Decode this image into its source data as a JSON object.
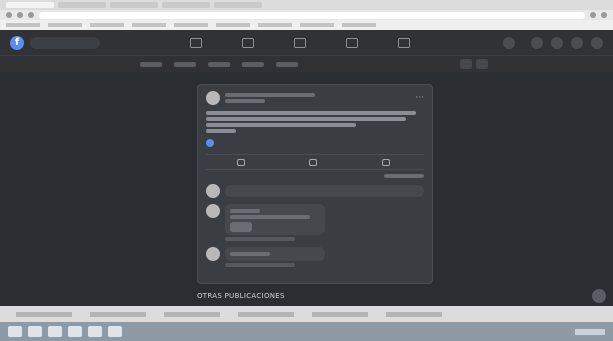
{
  "browser": {
    "address": ""
  },
  "facebook": {
    "search_placeholder": "",
    "profile_name": ""
  },
  "post": {
    "author": "",
    "text": "",
    "reactions_count": "",
    "comments_shares": "",
    "action_like": "",
    "action_comment": "",
    "action_share": "",
    "sort_label": ""
  },
  "comments": [
    {
      "author": "",
      "text": ""
    },
    {
      "author": "",
      "text": ""
    }
  ],
  "footer": {
    "otras_label": "OTRAS PUBLICACIONES"
  },
  "colors": {
    "accent": "#5b8def",
    "background": "#2a2d31",
    "card": "#3a3d42"
  }
}
